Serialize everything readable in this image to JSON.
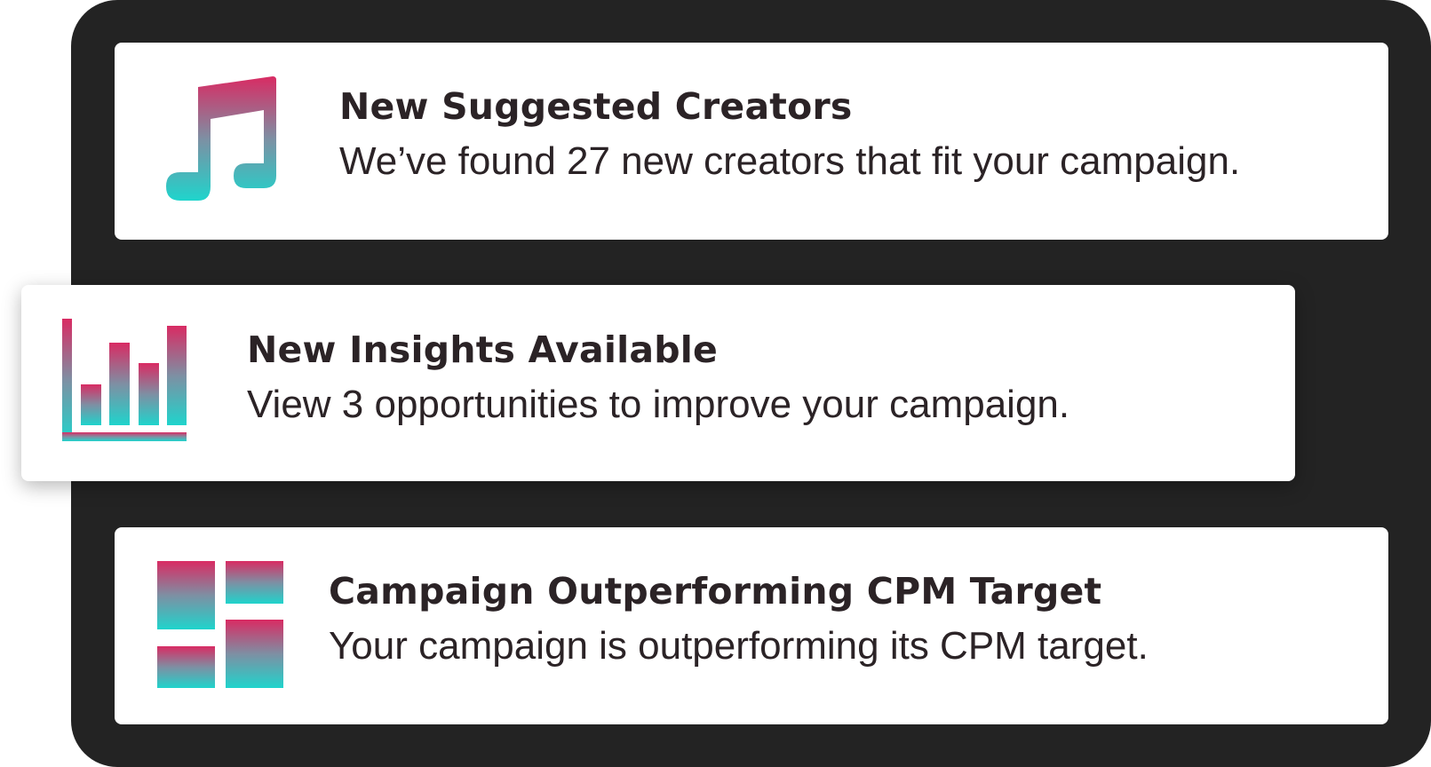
{
  "colors": {
    "panel": "#232323",
    "card": "#ffffff",
    "text": "#2b2326",
    "gradient_top": "#d92b63",
    "gradient_bottom": "#1fd4cc"
  },
  "notifications": [
    {
      "icon": "music-note-icon",
      "title": "New Suggested Creators",
      "description": "We’ve found 27 new creators that fit your campaign."
    },
    {
      "icon": "bar-chart-icon",
      "title": "New Insights Available",
      "description": "View 3 opportunities to improve your campaign."
    },
    {
      "icon": "dashboard-grid-icon",
      "title": "Campaign Outperforming CPM Target",
      "description": "Your campaign is outperforming its CPM target."
    }
  ]
}
